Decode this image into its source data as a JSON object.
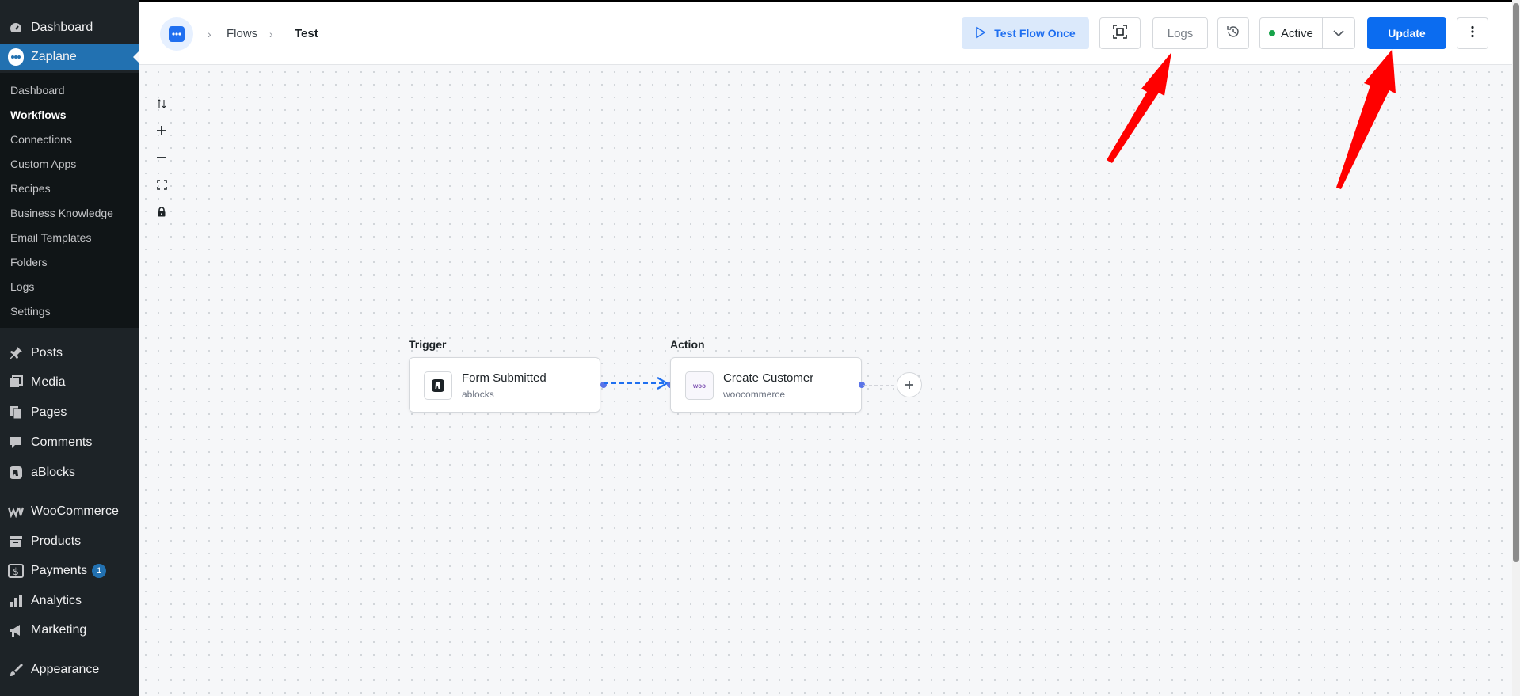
{
  "sidebar": {
    "top_items": [
      {
        "label": "Dashboard",
        "icon": "dashboard-gauge-icon"
      },
      {
        "label": "Zaplane",
        "icon": "zaplane-logo-icon"
      }
    ],
    "submenu": [
      "Dashboard",
      "Workflows",
      "Connections",
      "Custom Apps",
      "Recipes",
      "Business Knowledge",
      "Email Templates",
      "Folders",
      "Logs",
      "Settings"
    ],
    "submenu_current": "Workflows",
    "items": [
      {
        "label": "Posts",
        "icon": "pushpin-icon"
      },
      {
        "label": "Media",
        "icon": "media-icon"
      },
      {
        "label": "Pages",
        "icon": "pages-icon"
      },
      {
        "label": "Comments",
        "icon": "comment-icon"
      },
      {
        "label": "aBlocks",
        "icon": "ablocks-icon"
      },
      {
        "label": "WooCommerce",
        "icon": "woocommerce-icon"
      },
      {
        "label": "Products",
        "icon": "archive-icon"
      },
      {
        "label": "Payments",
        "icon": "dollar-icon",
        "badge": "1"
      },
      {
        "label": "Analytics",
        "icon": "bar-chart-icon"
      },
      {
        "label": "Marketing",
        "icon": "megaphone-icon"
      },
      {
        "label": "Appearance",
        "icon": "paintbrush-icon"
      }
    ]
  },
  "header": {
    "breadcrumb": [
      "Flows",
      "Test"
    ],
    "test_flow_label": "Test Flow Once",
    "logs_label": "Logs",
    "status_label": "Active",
    "update_label": "Update"
  },
  "flow": {
    "trigger": {
      "heading": "Trigger",
      "title": "Form Submitted",
      "app": "ablocks"
    },
    "action": {
      "heading": "Action",
      "title": "Create Customer",
      "app": "woocommerce",
      "icon_text": "woo"
    }
  },
  "colors": {
    "sidebar_bg": "#1d2327",
    "accent": "#2271b1",
    "primary_button": "#0b6cf0",
    "status_active": "#16a34a",
    "edge": "#1f6ff0",
    "annotation_arrow": "#ff0000"
  }
}
